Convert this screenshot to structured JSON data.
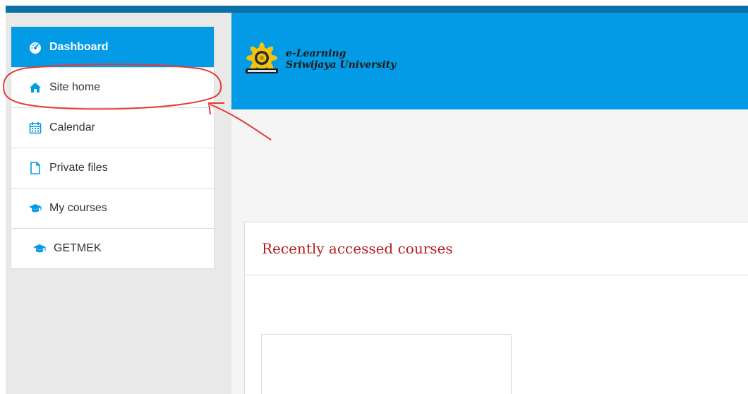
{
  "nav": {
    "items": [
      {
        "label": "Dashboard",
        "icon": "dashboard-icon",
        "active": true
      },
      {
        "label": "Site home",
        "icon": "home-icon"
      },
      {
        "label": "Calendar",
        "icon": "calendar-icon"
      },
      {
        "label": "Private files",
        "icon": "file-icon"
      },
      {
        "label": "My courses",
        "icon": "graduation-cap-icon"
      },
      {
        "label": "GETMEK",
        "icon": "graduation-cap-icon"
      }
    ]
  },
  "header": {
    "logo_line1": "e-Learning",
    "logo_line2": "Sriwijaya University"
  },
  "main": {
    "card_title": "Recently accessed courses"
  },
  "colors": {
    "accent": "#039be5",
    "top_bar": "#0b70a8",
    "card_title": "#b71c1c",
    "annotation": "#e53935",
    "icon": "#039be5"
  }
}
